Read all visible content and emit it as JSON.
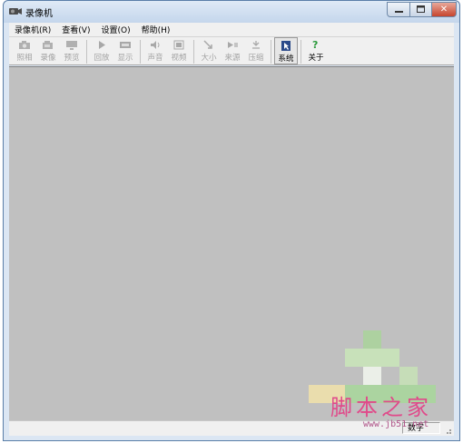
{
  "window": {
    "title": "录像机"
  },
  "menu": [
    "录像机(R)",
    "查看(V)",
    "设置(O)",
    "帮助(H)"
  ],
  "toolbar": {
    "photo": "照相",
    "record": "录像",
    "preview": "预览",
    "playback": "回放",
    "display": "显示",
    "audio": "声音",
    "video": "视频",
    "size": "大小",
    "source": "来源",
    "compress": "压缩",
    "system": "系统",
    "about": "关于"
  },
  "status": {
    "panel": "数字"
  },
  "watermark": {
    "text": "脚本之家",
    "url": "www.jb51.net"
  },
  "colors": {
    "client_bg": "#c0c0c0",
    "watermark": "#e04a8a"
  }
}
